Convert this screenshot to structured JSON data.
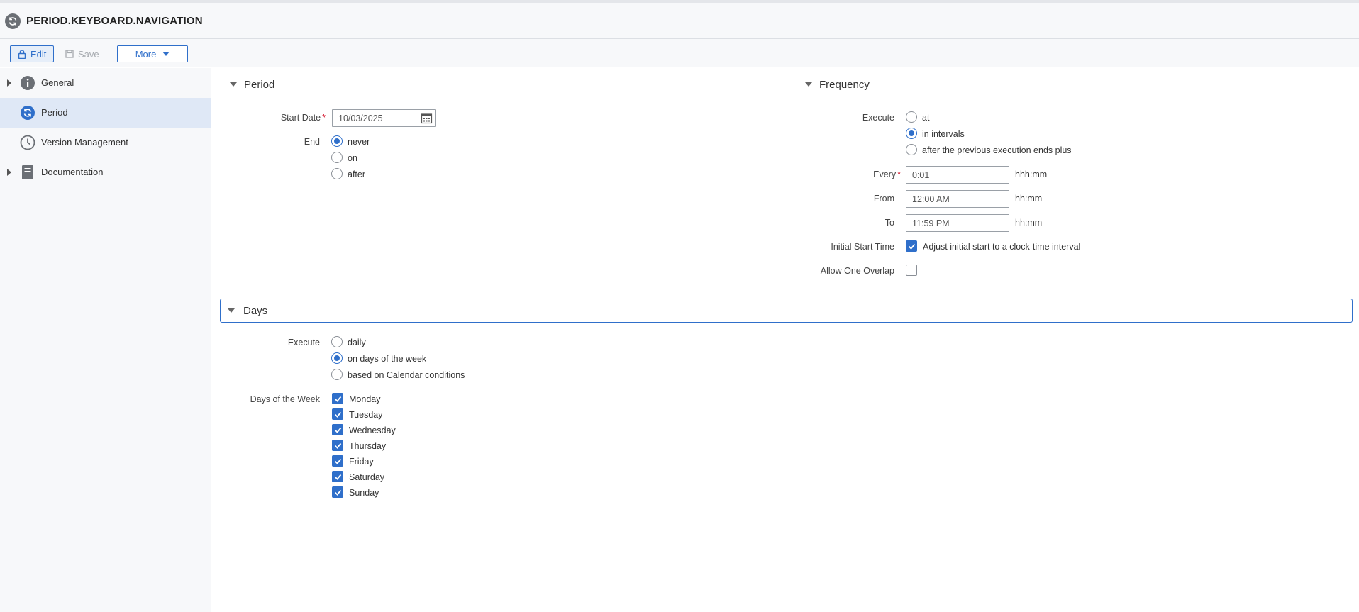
{
  "header": {
    "title": "PERIOD.KEYBOARD.NAVIGATION",
    "icon": "refresh-icon"
  },
  "toolbar": {
    "edit_label": "Edit",
    "save_label": "Save",
    "more_label": "More"
  },
  "sidebar": {
    "items": [
      {
        "label": "General",
        "icon": "info-icon",
        "expandable": true,
        "active": false
      },
      {
        "label": "Period",
        "icon": "refresh-icon",
        "expandable": false,
        "active": true
      },
      {
        "label": "Version Management",
        "icon": "clock-icon",
        "expandable": false,
        "active": false
      },
      {
        "label": "Documentation",
        "icon": "document-icon",
        "expandable": true,
        "active": false
      }
    ]
  },
  "period": {
    "title": "Period",
    "start_date_label": "Start Date",
    "start_date_value": "10/03/2025",
    "end_label": "End",
    "end_options": [
      "never",
      "on",
      "after"
    ],
    "end_selected": "never"
  },
  "frequency": {
    "title": "Frequency",
    "execute_label": "Execute",
    "execute_options": [
      "at",
      "in intervals",
      "after the previous execution ends plus"
    ],
    "execute_selected": "in intervals",
    "every_label": "Every",
    "every_value": "0:01",
    "every_unit": "hhh:mm",
    "from_label": "From",
    "from_value": "12:00 AM",
    "from_unit": "hh:mm",
    "to_label": "To",
    "to_value": "11:59 PM",
    "to_unit": "hh:mm",
    "initial_start_label": "Initial Start Time",
    "initial_start_checkbox_label": "Adjust initial start to a clock-time interval",
    "initial_start_checked": true,
    "allow_overlap_label": "Allow One Overlap",
    "allow_overlap_checked": false
  },
  "days": {
    "title": "Days",
    "execute_label": "Execute",
    "execute_options": [
      "daily",
      "on days of the week",
      "based on Calendar conditions"
    ],
    "execute_selected": "on days of the week",
    "days_label": "Days of the Week",
    "weekdays": [
      "Monday",
      "Tuesday",
      "Wednesday",
      "Thursday",
      "Friday",
      "Saturday",
      "Sunday"
    ]
  },
  "colors": {
    "accent": "#2f6fca",
    "required": "#d0021b",
    "sidebar_active": "#dfe8f6"
  }
}
